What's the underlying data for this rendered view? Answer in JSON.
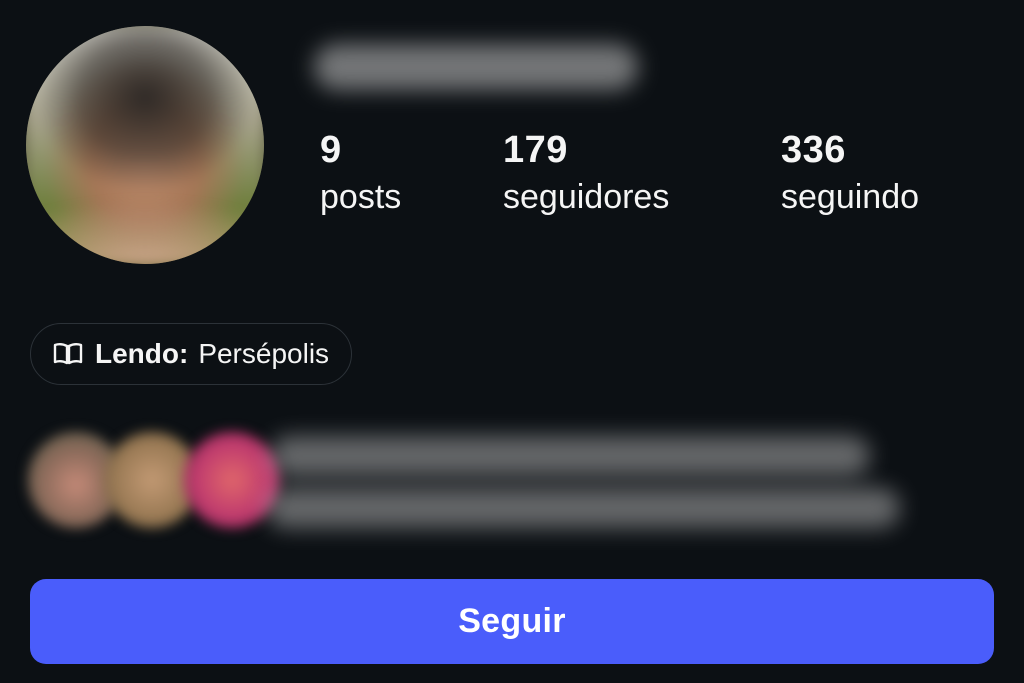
{
  "profile": {
    "stats": [
      {
        "value": "9",
        "label": "posts"
      },
      {
        "value": "179",
        "label": "seguidores"
      },
      {
        "value": "336",
        "label": "seguindo"
      }
    ]
  },
  "reading": {
    "icon": "book-open-icon",
    "prefix": "Lendo:",
    "title": "Persépolis"
  },
  "actions": {
    "follow_label": "Seguir",
    "follow_color": "#4a5dfb"
  },
  "theme": {
    "background": "#0c1014",
    "text": "#f5f5f5"
  }
}
